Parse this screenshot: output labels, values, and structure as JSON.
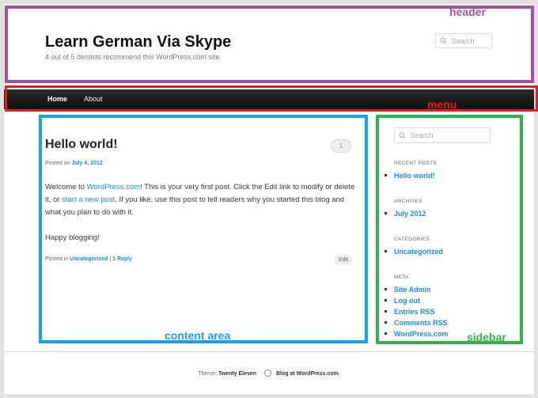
{
  "header": {
    "site_title": "Learn German Via Skype",
    "tagline": "4 out of 5 dentists recommend this WordPress.com site",
    "search_placeholder": "Search"
  },
  "menu": {
    "items": [
      "Home",
      "About"
    ]
  },
  "post": {
    "title": "Hello world!",
    "comment_count": "1",
    "posted_on_prefix": "Posted on",
    "date": "July 4, 2012",
    "para1_a": "Welcome to ",
    "para1_link1": "WordPress.com",
    "para1_b": "! This is your very first post. Click the Edit link to modify or delete it, or ",
    "para1_link2": "start a new post",
    "para1_c": ". If you like, use this post to tell readers why you started this blog and what you plan to do with it.",
    "para2": "Happy blogging!",
    "posted_in_prefix": "Posted in",
    "category": "Uncategorized",
    "separator": "|",
    "replies": "1 Reply",
    "edit_label": "Edit"
  },
  "sidebar": {
    "search_placeholder": "Search",
    "recent_posts_title": "RECENT POSTS",
    "recent_posts": [
      "Hello world!"
    ],
    "archives_title": "ARCHIVES",
    "archives": [
      "July 2012"
    ],
    "categories_title": "CATEGORIES",
    "categories": [
      "Uncategorized"
    ],
    "meta_title": "META",
    "meta": [
      "Site Admin",
      "Log out",
      "Entries RSS",
      "Comments RSS",
      "WordPress.com"
    ]
  },
  "footer": {
    "theme_prefix": "Theme:",
    "theme_name": "Twenty Eleven",
    "blog_at": "Blog at WordPress.com."
  },
  "annotations": {
    "header": "header",
    "menu": "menu",
    "content": "content area",
    "sidebar": "sidebar",
    "colors": {
      "header": "#a550a7",
      "menu": "#e51d1d",
      "content": "#1aa0e6",
      "sidebar": "#2eb24a"
    }
  }
}
